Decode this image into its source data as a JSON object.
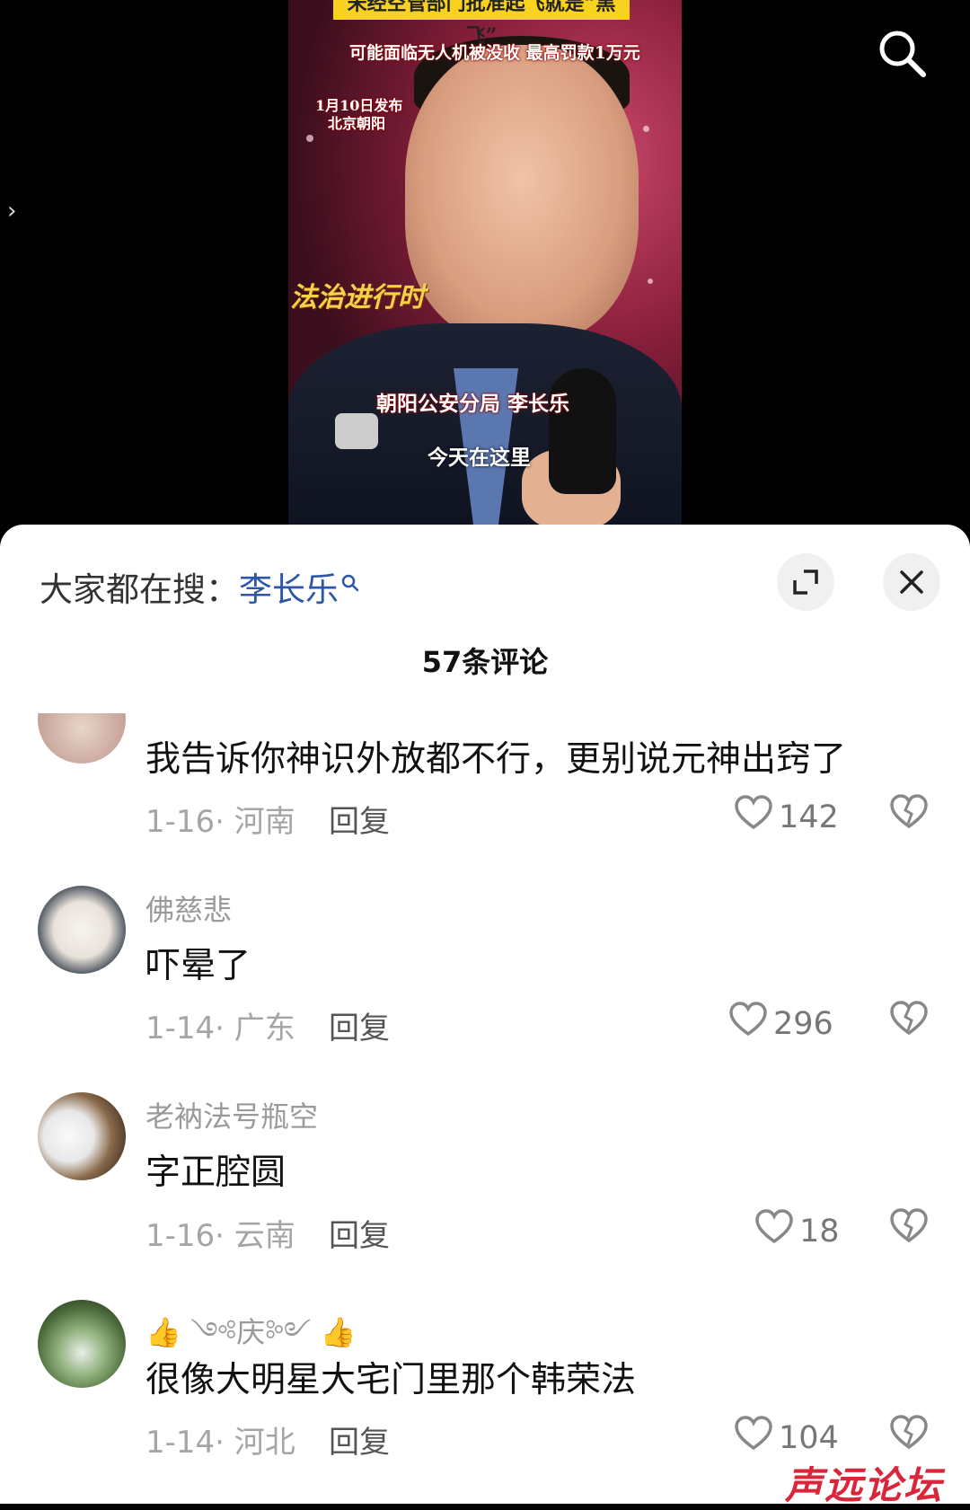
{
  "video": {
    "top_banner": "未经空管部门批准起飞就是“黑飞”",
    "subtitle_line": "可能面临无人机被没收 最高罚款1万元",
    "publish_date": "1月10日发布",
    "publish_place": "北京朝阳",
    "program_logo": "法治进行时",
    "speaker_caption": "朝阳公安分局 李长乐",
    "speech_caption": "今天在这里"
  },
  "sheet": {
    "search_hint_prefix": "大家都在搜：",
    "search_hint_keyword": "李长乐",
    "comment_count": "57条评论"
  },
  "comments": [
    {
      "username": "",
      "text": "我告诉你神识外放都不行，更别说元神出窍了",
      "date": "1-16",
      "region": "河南",
      "reply": "回复",
      "likes": "142"
    },
    {
      "username": "佛慈悲",
      "text": "吓晕了",
      "date": "1-14",
      "region": "广东",
      "reply": "回复",
      "likes": "296"
    },
    {
      "username": "老衲法号瓶空",
      "text": "字正腔圆",
      "date": "1-16",
      "region": "云南",
      "reply": "回复",
      "likes": "18"
    },
    {
      "username": "👍 ༺庆༻ 👍",
      "text": "很像大明星大宅门里那个韩荣法",
      "date": "1-14",
      "region": "河北",
      "reply": "回复",
      "likes": "104"
    }
  ],
  "watermark": "声远论坛",
  "icons": {
    "search": "search-icon",
    "expand": "expand-icon",
    "close": "close-icon",
    "like": "heart-icon",
    "dislike": "broken-heart-icon"
  },
  "colors": {
    "keyword": "#2e56a8",
    "banner": "#f7d21e",
    "watermark": "#d9263a"
  }
}
